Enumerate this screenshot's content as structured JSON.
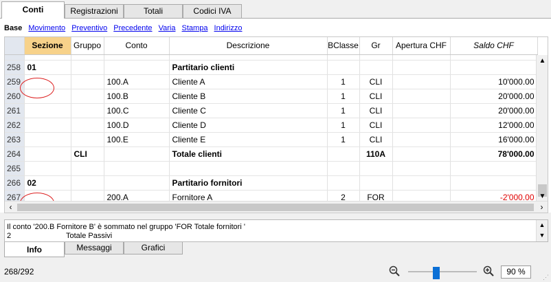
{
  "tabs": [
    "Conti",
    "Registrazioni",
    "Totali",
    "Codici IVA"
  ],
  "subtabs": {
    "active": "Base",
    "links": [
      "Movimento",
      "Preventivo",
      "Precedente",
      "Varia",
      "Stampa",
      "Indirizzo"
    ]
  },
  "table": {
    "headers": [
      "Sezione",
      "Gruppo",
      "Conto",
      "Descrizione",
      "BClasse",
      "Gr",
      "Apertura CHF",
      "Saldo CHF"
    ],
    "rows": [
      {
        "n": "258",
        "sezione": "01",
        "gruppo": "",
        "conto": "",
        "descrizione": "Partitario clienti",
        "bclasse": "",
        "gr": "",
        "apertura": "",
        "saldo": "",
        "bold": true
      },
      {
        "n": "259",
        "sezione": "",
        "gruppo": "",
        "conto": "100.A",
        "descrizione": "Cliente A",
        "bclasse": "1",
        "gr": "CLI",
        "apertura": "",
        "saldo": "10'000.00"
      },
      {
        "n": "260",
        "sezione": "",
        "gruppo": "",
        "conto": "100.B",
        "descrizione": "Cliente B",
        "bclasse": "1",
        "gr": "CLI",
        "apertura": "",
        "saldo": "20'000.00"
      },
      {
        "n": "261",
        "sezione": "",
        "gruppo": "",
        "conto": "100.C",
        "descrizione": "Cliente C",
        "bclasse": "1",
        "gr": "CLI",
        "apertura": "",
        "saldo": "20'000.00"
      },
      {
        "n": "262",
        "sezione": "",
        "gruppo": "",
        "conto": "100.D",
        "descrizione": "Cliente D",
        "bclasse": "1",
        "gr": "CLI",
        "apertura": "",
        "saldo": "12'000.00"
      },
      {
        "n": "263",
        "sezione": "",
        "gruppo": "",
        "conto": "100.E",
        "descrizione": "Cliente E",
        "bclasse": "1",
        "gr": "CLI",
        "apertura": "",
        "saldo": "16'000.00"
      },
      {
        "n": "264",
        "sezione": "",
        "gruppo": "CLI",
        "conto": "",
        "descrizione": "Totale clienti",
        "bclasse": "",
        "gr": "110A",
        "apertura": "",
        "saldo": "78'000.00",
        "bold": true
      },
      {
        "n": "265",
        "sezione": "",
        "gruppo": "",
        "conto": "",
        "descrizione": "",
        "bclasse": "",
        "gr": "",
        "apertura": "",
        "saldo": ""
      },
      {
        "n": "266",
        "sezione": "02",
        "gruppo": "",
        "conto": "",
        "descrizione": "Partitario fornitori",
        "bclasse": "",
        "gr": "",
        "apertura": "",
        "saldo": "",
        "bold": true
      },
      {
        "n": "267",
        "sezione": "",
        "gruppo": "",
        "conto": "200.A",
        "descrizione": "Fornitore A",
        "bclasse": "2",
        "gr": "FOR",
        "apertura": "",
        "saldo": "-2'000.00",
        "negative": true
      }
    ]
  },
  "info": {
    "message": "Il conto '200.B Fornitore B' è sommato nel gruppo 'FOR Totale fornitori '",
    "line2_code": "2",
    "line2_text": "Totale Passivi"
  },
  "bottom_tabs": [
    "Info",
    "Messaggi",
    "Grafici"
  ],
  "status": {
    "count": "268/292",
    "zoom": "90 %",
    "zoom_level": 0.4
  },
  "colors": {
    "section_header": "#f7d28a",
    "row_number_bg": "#e2e7ef",
    "negative": "#e00000",
    "link": "#0000ee",
    "annotation": "#dd2222",
    "slider": "#0a6fd6"
  }
}
